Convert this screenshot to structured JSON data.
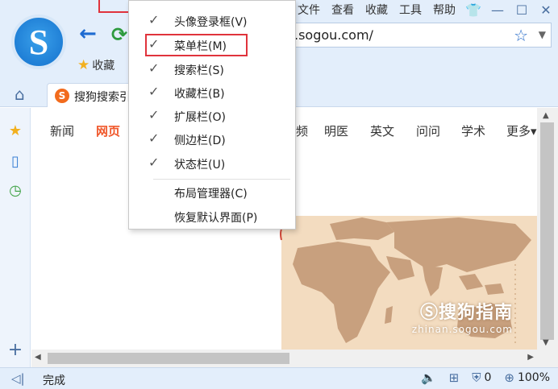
{
  "browser": {
    "logo_letter": "S",
    "menu": [
      "文件",
      "查看",
      "收藏",
      "工具",
      "帮助"
    ],
    "address": ".sogou.com/",
    "bookmarks_label": "收藏",
    "tab_title": "搜狗搜索引擎",
    "tab_icon_letter": "S"
  },
  "search_nav": {
    "items": [
      "新闻",
      "网页",
      "视频",
      "明医",
      "英文",
      "问问",
      "学术",
      "更多"
    ],
    "active_index": 1,
    "visible_partial_third": "频"
  },
  "context_menu": {
    "items": [
      {
        "label": "头像登录框(V)",
        "checked": true
      },
      {
        "label": "菜单栏(M)",
        "checked": true
      },
      {
        "label": "搜索栏(S)",
        "checked": true
      },
      {
        "label": "收藏栏(B)",
        "checked": true
      },
      {
        "label": "扩展栏(O)",
        "checked": true
      },
      {
        "label": "侧边栏(D)",
        "checked": true
      },
      {
        "label": "状态栏(U)",
        "checked": true
      },
      {
        "label": "布局管理器(C)",
        "checked": false
      },
      {
        "label": "恢复默认界面(P)",
        "checked": false
      }
    ],
    "check_glyph": "✓"
  },
  "watermark": {
    "main": "搜狗指南",
    "url": "zhinan.sogou.com"
  },
  "status": {
    "text": "完成",
    "adblock_count": "0",
    "zoom": "100%"
  },
  "colors": {
    "accent": "#1f7fd6",
    "active_nav": "#f0572a",
    "highlight_box": "#e0333c",
    "chrome_bg": "#e3eefb"
  }
}
